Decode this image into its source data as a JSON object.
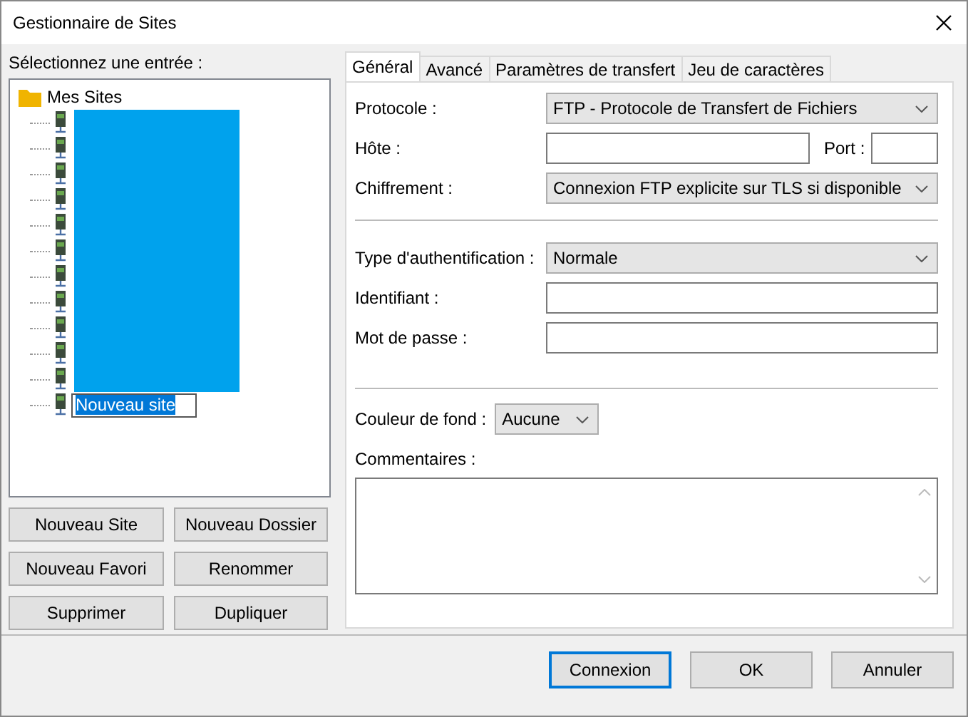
{
  "window": {
    "title": "Gestionnaire de Sites"
  },
  "tree_label": "Sélectionnez une entrée :",
  "tree": {
    "label": "Mes Sites",
    "kind": "folder",
    "children": [
      {
        "kind": "site",
        "redacted": true
      },
      {
        "kind": "site",
        "redacted": true
      },
      {
        "kind": "site",
        "redacted": true
      },
      {
        "kind": "site",
        "redacted": true
      },
      {
        "kind": "site",
        "redacted": true
      },
      {
        "kind": "site",
        "redacted": true
      },
      {
        "kind": "site",
        "redacted": true
      },
      {
        "kind": "site",
        "redacted": true
      },
      {
        "kind": "site",
        "redacted": true
      },
      {
        "kind": "site",
        "redacted": true
      },
      {
        "kind": "site",
        "redacted": true
      },
      {
        "kind": "site",
        "redacted": false,
        "label": "Nouveau site",
        "editing": true
      }
    ]
  },
  "tree_buttons": [
    "Nouveau Site",
    "Nouveau Dossier",
    "Nouveau Favori",
    "Renommer",
    "Supprimer",
    "Dupliquer"
  ],
  "tabs": [
    {
      "label": "Général",
      "selected": true
    },
    {
      "label": "Avancé",
      "selected": false
    },
    {
      "label": "Paramètres de transfert",
      "selected": false
    },
    {
      "label": "Jeu de caractères",
      "selected": false
    }
  ],
  "fields": [
    {
      "kind": "select",
      "label": "Protocole :",
      "value": "FTP - Protocole de Transfert de Fichiers"
    },
    {
      "kind": "host",
      "label": "Hôte :",
      "port_label": "Port :"
    },
    {
      "kind": "select",
      "label": "Chiffrement :",
      "value": "Connexion FTP explicite sur TLS si disponible"
    },
    {
      "kind": "separator"
    },
    {
      "kind": "select",
      "label": "Type d'authentification :",
      "value": "Normale"
    },
    {
      "kind": "text",
      "label": "Identifiant :"
    },
    {
      "kind": "text",
      "label": "Mot de passe :"
    }
  ],
  "background_color": {
    "label": "Couleur de fond :",
    "value": "Aucune"
  },
  "comments": {
    "label": "Commentaires :"
  },
  "buttons": [
    {
      "label": "Connexion",
      "default": true
    },
    {
      "label": "OK",
      "default": false
    },
    {
      "label": "Annuler",
      "default": false
    }
  ]
}
